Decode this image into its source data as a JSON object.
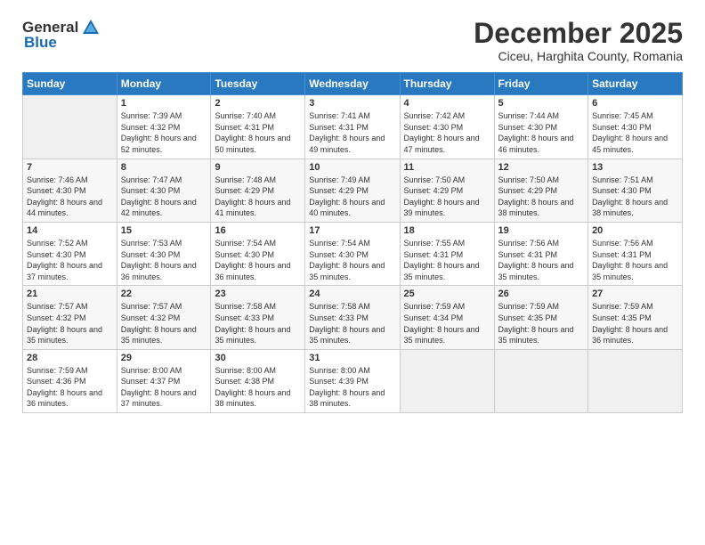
{
  "header": {
    "logo_general": "General",
    "logo_blue": "Blue",
    "month": "December 2025",
    "location": "Ciceu, Harghita County, Romania"
  },
  "days_of_week": [
    "Sunday",
    "Monday",
    "Tuesday",
    "Wednesday",
    "Thursday",
    "Friday",
    "Saturday"
  ],
  "weeks": [
    [
      {
        "num": "",
        "sunrise": "",
        "sunset": "",
        "daylight": ""
      },
      {
        "num": "1",
        "sunrise": "Sunrise: 7:39 AM",
        "sunset": "Sunset: 4:32 PM",
        "daylight": "Daylight: 8 hours and 52 minutes."
      },
      {
        "num": "2",
        "sunrise": "Sunrise: 7:40 AM",
        "sunset": "Sunset: 4:31 PM",
        "daylight": "Daylight: 8 hours and 50 minutes."
      },
      {
        "num": "3",
        "sunrise": "Sunrise: 7:41 AM",
        "sunset": "Sunset: 4:31 PM",
        "daylight": "Daylight: 8 hours and 49 minutes."
      },
      {
        "num": "4",
        "sunrise": "Sunrise: 7:42 AM",
        "sunset": "Sunset: 4:30 PM",
        "daylight": "Daylight: 8 hours and 47 minutes."
      },
      {
        "num": "5",
        "sunrise": "Sunrise: 7:44 AM",
        "sunset": "Sunset: 4:30 PM",
        "daylight": "Daylight: 8 hours and 46 minutes."
      },
      {
        "num": "6",
        "sunrise": "Sunrise: 7:45 AM",
        "sunset": "Sunset: 4:30 PM",
        "daylight": "Daylight: 8 hours and 45 minutes."
      }
    ],
    [
      {
        "num": "7",
        "sunrise": "Sunrise: 7:46 AM",
        "sunset": "Sunset: 4:30 PM",
        "daylight": "Daylight: 8 hours and 44 minutes."
      },
      {
        "num": "8",
        "sunrise": "Sunrise: 7:47 AM",
        "sunset": "Sunset: 4:30 PM",
        "daylight": "Daylight: 8 hours and 42 minutes."
      },
      {
        "num": "9",
        "sunrise": "Sunrise: 7:48 AM",
        "sunset": "Sunset: 4:29 PM",
        "daylight": "Daylight: 8 hours and 41 minutes."
      },
      {
        "num": "10",
        "sunrise": "Sunrise: 7:49 AM",
        "sunset": "Sunset: 4:29 PM",
        "daylight": "Daylight: 8 hours and 40 minutes."
      },
      {
        "num": "11",
        "sunrise": "Sunrise: 7:50 AM",
        "sunset": "Sunset: 4:29 PM",
        "daylight": "Daylight: 8 hours and 39 minutes."
      },
      {
        "num": "12",
        "sunrise": "Sunrise: 7:50 AM",
        "sunset": "Sunset: 4:29 PM",
        "daylight": "Daylight: 8 hours and 38 minutes."
      },
      {
        "num": "13",
        "sunrise": "Sunrise: 7:51 AM",
        "sunset": "Sunset: 4:30 PM",
        "daylight": "Daylight: 8 hours and 38 minutes."
      }
    ],
    [
      {
        "num": "14",
        "sunrise": "Sunrise: 7:52 AM",
        "sunset": "Sunset: 4:30 PM",
        "daylight": "Daylight: 8 hours and 37 minutes."
      },
      {
        "num": "15",
        "sunrise": "Sunrise: 7:53 AM",
        "sunset": "Sunset: 4:30 PM",
        "daylight": "Daylight: 8 hours and 36 minutes."
      },
      {
        "num": "16",
        "sunrise": "Sunrise: 7:54 AM",
        "sunset": "Sunset: 4:30 PM",
        "daylight": "Daylight: 8 hours and 36 minutes."
      },
      {
        "num": "17",
        "sunrise": "Sunrise: 7:54 AM",
        "sunset": "Sunset: 4:30 PM",
        "daylight": "Daylight: 8 hours and 35 minutes."
      },
      {
        "num": "18",
        "sunrise": "Sunrise: 7:55 AM",
        "sunset": "Sunset: 4:31 PM",
        "daylight": "Daylight: 8 hours and 35 minutes."
      },
      {
        "num": "19",
        "sunrise": "Sunrise: 7:56 AM",
        "sunset": "Sunset: 4:31 PM",
        "daylight": "Daylight: 8 hours and 35 minutes."
      },
      {
        "num": "20",
        "sunrise": "Sunrise: 7:56 AM",
        "sunset": "Sunset: 4:31 PM",
        "daylight": "Daylight: 8 hours and 35 minutes."
      }
    ],
    [
      {
        "num": "21",
        "sunrise": "Sunrise: 7:57 AM",
        "sunset": "Sunset: 4:32 PM",
        "daylight": "Daylight: 8 hours and 35 minutes."
      },
      {
        "num": "22",
        "sunrise": "Sunrise: 7:57 AM",
        "sunset": "Sunset: 4:32 PM",
        "daylight": "Daylight: 8 hours and 35 minutes."
      },
      {
        "num": "23",
        "sunrise": "Sunrise: 7:58 AM",
        "sunset": "Sunset: 4:33 PM",
        "daylight": "Daylight: 8 hours and 35 minutes."
      },
      {
        "num": "24",
        "sunrise": "Sunrise: 7:58 AM",
        "sunset": "Sunset: 4:33 PM",
        "daylight": "Daylight: 8 hours and 35 minutes."
      },
      {
        "num": "25",
        "sunrise": "Sunrise: 7:59 AM",
        "sunset": "Sunset: 4:34 PM",
        "daylight": "Daylight: 8 hours and 35 minutes."
      },
      {
        "num": "26",
        "sunrise": "Sunrise: 7:59 AM",
        "sunset": "Sunset: 4:35 PM",
        "daylight": "Daylight: 8 hours and 35 minutes."
      },
      {
        "num": "27",
        "sunrise": "Sunrise: 7:59 AM",
        "sunset": "Sunset: 4:35 PM",
        "daylight": "Daylight: 8 hours and 36 minutes."
      }
    ],
    [
      {
        "num": "28",
        "sunrise": "Sunrise: 7:59 AM",
        "sunset": "Sunset: 4:36 PM",
        "daylight": "Daylight: 8 hours and 36 minutes."
      },
      {
        "num": "29",
        "sunrise": "Sunrise: 8:00 AM",
        "sunset": "Sunset: 4:37 PM",
        "daylight": "Daylight: 8 hours and 37 minutes."
      },
      {
        "num": "30",
        "sunrise": "Sunrise: 8:00 AM",
        "sunset": "Sunset: 4:38 PM",
        "daylight": "Daylight: 8 hours and 38 minutes."
      },
      {
        "num": "31",
        "sunrise": "Sunrise: 8:00 AM",
        "sunset": "Sunset: 4:39 PM",
        "daylight": "Daylight: 8 hours and 38 minutes."
      },
      {
        "num": "",
        "sunrise": "",
        "sunset": "",
        "daylight": ""
      },
      {
        "num": "",
        "sunrise": "",
        "sunset": "",
        "daylight": ""
      },
      {
        "num": "",
        "sunrise": "",
        "sunset": "",
        "daylight": ""
      }
    ]
  ]
}
